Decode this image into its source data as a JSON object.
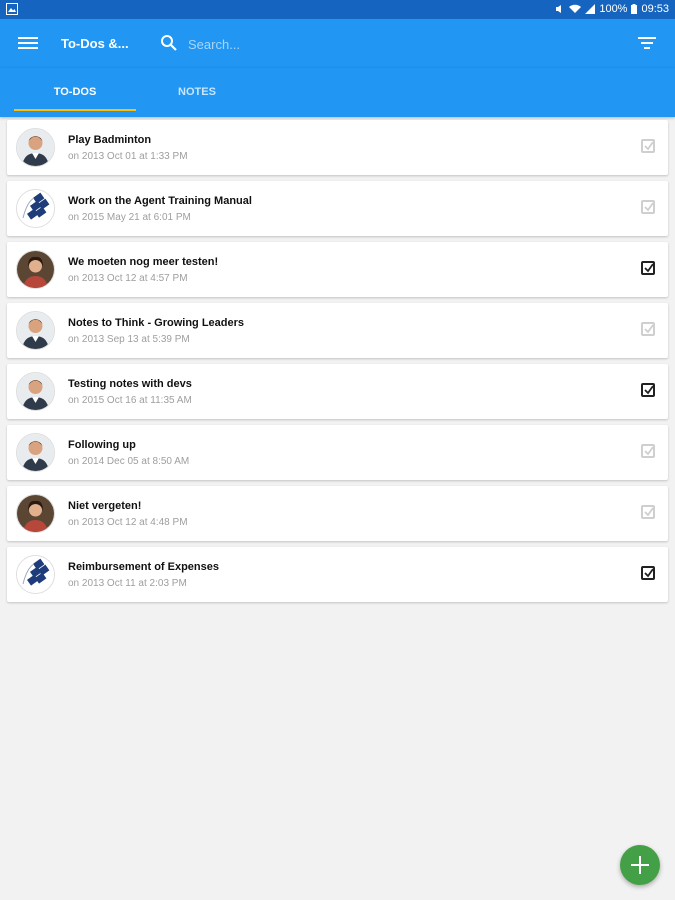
{
  "status_bar": {
    "battery": "100%",
    "time": "09:53"
  },
  "app_bar": {
    "title": "To-Dos &...",
    "search_placeholder": "Search...",
    "menu_icon": "hamburger-menu-icon",
    "search_icon": "search-icon",
    "filter_icon": "filter-icon"
  },
  "tabs": [
    {
      "label": "TO-DOS",
      "active": true
    },
    {
      "label": "NOTES",
      "active": false
    }
  ],
  "colors": {
    "status_bar": "#1565c0",
    "primary": "#2196f3",
    "tab_indicator": "#ffc107",
    "fab": "#43a047",
    "background": "#f2f2f2"
  },
  "items": [
    {
      "title": "Play Badminton",
      "date": "on 2013 Oct 01 at 1:33 PM",
      "avatar": "man-photo",
      "checked": false
    },
    {
      "title": "Work on the Agent Training Manual",
      "date": "on 2015 May 21 at 6:01 PM",
      "avatar": "company-logo",
      "checked": false
    },
    {
      "title": "We moeten nog meer testen!",
      "date": "on 2013 Oct 12 at 4:57 PM",
      "avatar": "woman-photo",
      "checked": true
    },
    {
      "title": "Notes to Think - Growing Leaders",
      "date": "on 2013 Sep 13 at 5:39 PM",
      "avatar": "man-photo",
      "checked": false
    },
    {
      "title": "Testing notes with devs",
      "date": "on 2015 Oct 16 at 11:35 AM",
      "avatar": "man-photo",
      "checked": true
    },
    {
      "title": "Following up",
      "date": "on 2014 Dec 05 at 8:50 AM",
      "avatar": "man-photo",
      "checked": false
    },
    {
      "title": "Niet vergeten!",
      "date": "on 2013 Oct 12 at 4:48 PM",
      "avatar": "woman-photo",
      "checked": false
    },
    {
      "title": "Reimbursement of Expenses",
      "date": "on 2013 Oct 11 at 2:03 PM",
      "avatar": "company-logo",
      "checked": true
    }
  ],
  "fab": {
    "icon": "plus-icon"
  }
}
